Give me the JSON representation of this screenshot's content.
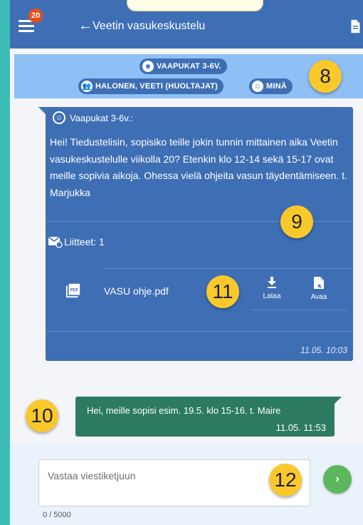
{
  "header": {
    "notification_count": "20",
    "back_arrow": "←",
    "title": "Veetin vasukeskustelu",
    "menu_icon": "hamburger-menu-icon",
    "doc_icon": "document-icon"
  },
  "recipients": {
    "group_chip": "VAAPUKAT 3-6V.",
    "guardians_chip": "HALONEN, VEETI (HUOLTAJAT)",
    "self_chip": "MINÄ"
  },
  "markers": {
    "m8": "8",
    "m9": "9",
    "m10": "10",
    "m11": "11",
    "m12": "12"
  },
  "incoming_message": {
    "sender": "Vaapukat 3-6v.:",
    "body": "Hei! Tiedustelisin, sopisiko teille jokin tunnin mittainen aika Veetin vasukeskustelulle viikolla 20? Etenkin klo 12-14 sekä 15-17 ovat meille sopivia aikoja. Ohessa vielä ohjeita vasun täydentämiseen. t. Marjukka",
    "attachments_label": "Liitteet: 1",
    "attachment_name": "VASU ohje.pdf",
    "download_label": "Lataa",
    "open_label": "Avaa",
    "timestamp": "11.05. 10:03"
  },
  "outgoing_message": {
    "body": "Hei, meille sopisi esim. 19.5. klo 15-16. t. Maire",
    "timestamp": "11.05. 11:53"
  },
  "compose": {
    "placeholder": "Vastaa viestiketjuun",
    "value": "",
    "counter": "0 / 5000",
    "send_glyph": "›"
  },
  "colors": {
    "header": "#3e6fb5",
    "recipient_bar": "#8fc0f5",
    "incoming_bubble": "#3e6fb5",
    "outgoing_bubble": "#2d7a63",
    "badge": "#ea4c1d",
    "marker": "#f9c92c",
    "send_button": "#5cb85c",
    "page_border": "#3dbdb8"
  }
}
